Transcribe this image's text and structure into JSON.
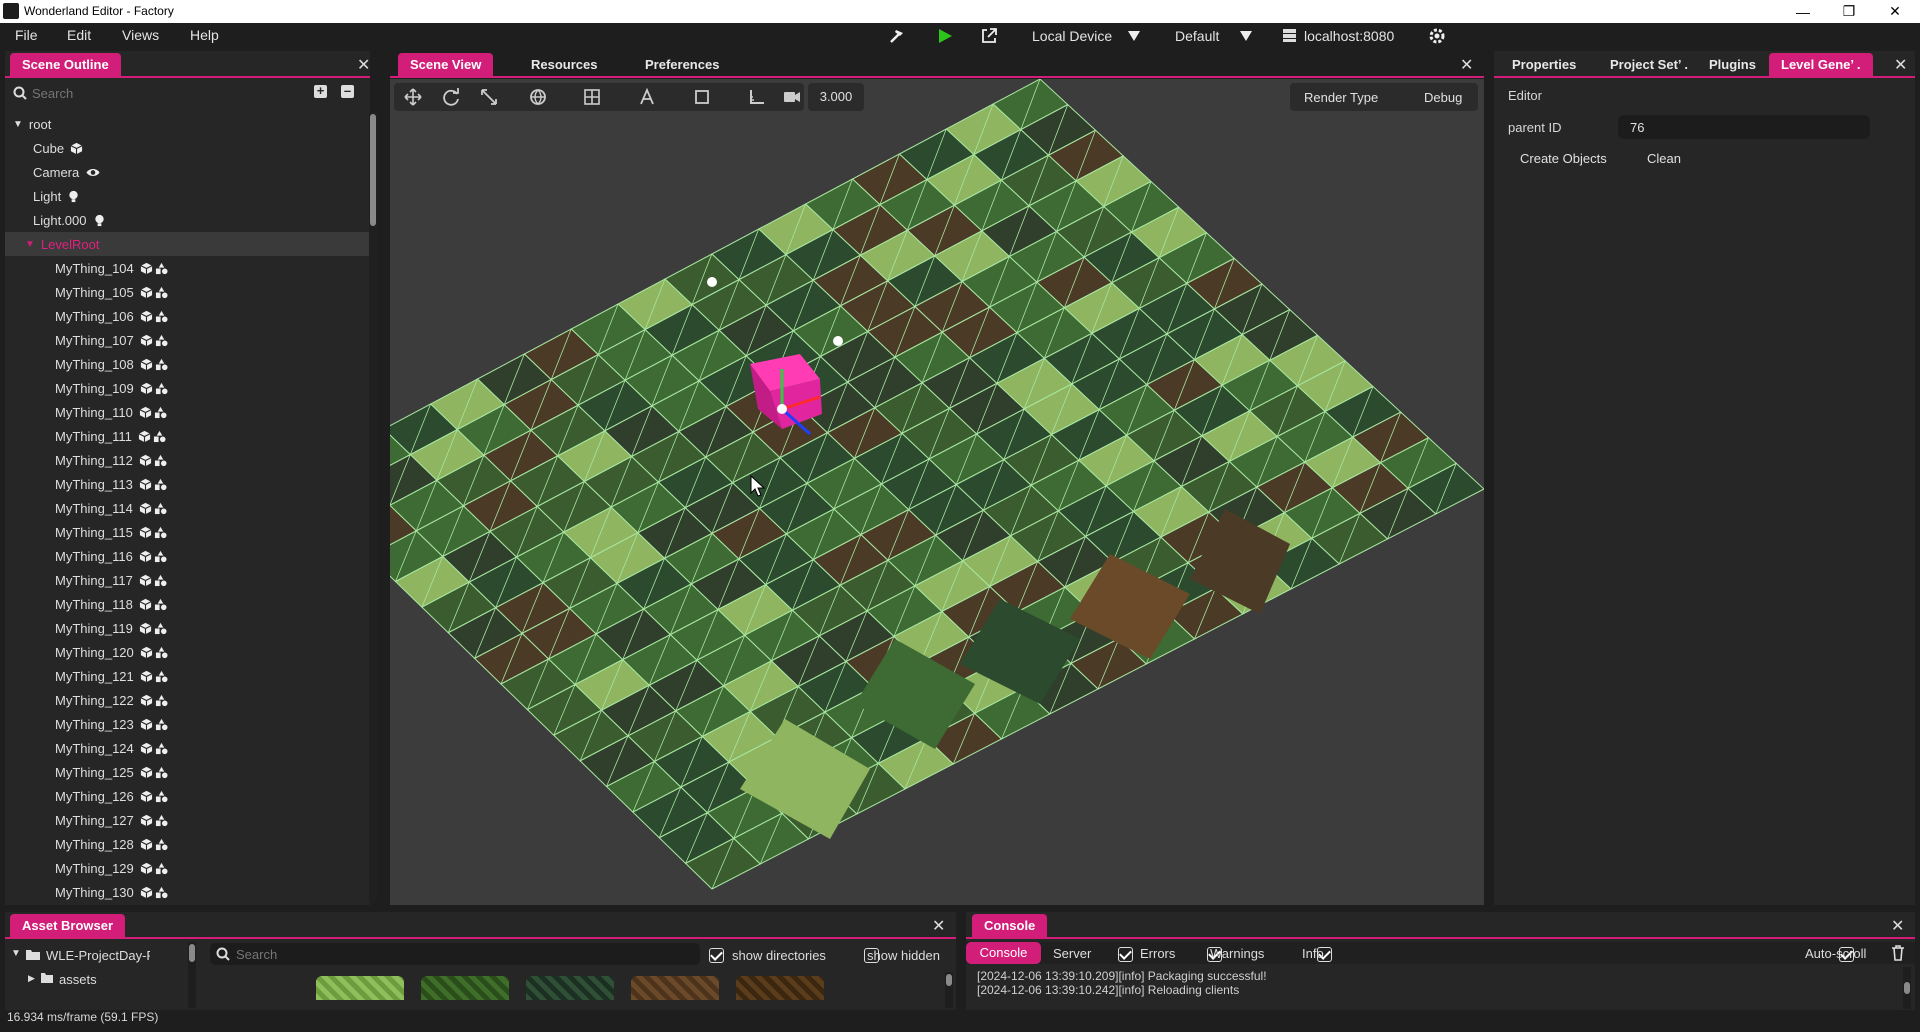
{
  "window": {
    "title": "Wonderland Editor - Factory"
  },
  "menu": [
    "File",
    "Edit",
    "Views",
    "Help"
  ],
  "toolbar": {
    "device": "Local Device",
    "profile": "Default",
    "server": "localhost:8080"
  },
  "scene_outline": {
    "tab": "Scene Outline",
    "search_placeholder": "Search",
    "items": [
      {
        "label": "root"
      },
      {
        "label": "Cube"
      },
      {
        "label": "Camera"
      },
      {
        "label": "Light"
      },
      {
        "label": "Light.000"
      },
      {
        "label": "LevelRoot"
      },
      {
        "label": "MyThing_104"
      },
      {
        "label": "MyThing_105"
      },
      {
        "label": "MyThing_106"
      },
      {
        "label": "MyThing_107"
      },
      {
        "label": "MyThing_108"
      },
      {
        "label": "MyThing_109"
      },
      {
        "label": "MyThing_110"
      },
      {
        "label": "MyThing_111"
      },
      {
        "label": "MyThing_112"
      },
      {
        "label": "MyThing_113"
      },
      {
        "label": "MyThing_114"
      },
      {
        "label": "MyThing_115"
      },
      {
        "label": "MyThing_116"
      },
      {
        "label": "MyThing_117"
      },
      {
        "label": "MyThing_118"
      },
      {
        "label": "MyThing_119"
      },
      {
        "label": "MyThing_120"
      },
      {
        "label": "MyThing_121"
      },
      {
        "label": "MyThing_122"
      },
      {
        "label": "MyThing_123"
      },
      {
        "label": "MyThing_124"
      },
      {
        "label": "MyThing_125"
      },
      {
        "label": "MyThing_126"
      },
      {
        "label": "MyThing_127"
      },
      {
        "label": "MyThing_128"
      },
      {
        "label": "MyThing_129"
      },
      {
        "label": "MyThing_130"
      }
    ]
  },
  "center_tabs": {
    "scene_view": "Scene View",
    "resources": "Resources",
    "preferences": "Preferences"
  },
  "scene_view": {
    "zoom": "3.000",
    "render_type": "Render Type",
    "debug": "Debug"
  },
  "right_tabs": {
    "properties": "Properties",
    "project_settings": "Project Set’ .",
    "plugins": "Plugins",
    "level_generator": "Level Gene’ ."
  },
  "level_gen": {
    "section": "Editor",
    "parent_id_label": "parent ID",
    "parent_id_value": "76",
    "create_objects": "Create Objects",
    "clean": "Clean"
  },
  "asset_browser": {
    "tab": "Asset Browser",
    "root_folder": "WLE-ProjectDay-Facto",
    "sub_folder": "assets",
    "search_placeholder": "Search",
    "show_directories": "show directories",
    "show_hidden": "show hidden"
  },
  "console": {
    "tab": "Console",
    "sub_tabs": {
      "console": "Console",
      "server": "Server"
    },
    "filters": {
      "errors": "Errors",
      "warnings": "Warnings",
      "info": "Info",
      "autoscroll": "Auto-scroll"
    },
    "lines": [
      "[2024-12-06 13:39:10.209][info] Packaging successful!",
      "[2024-12-06 13:39:10.242][info] Reloading clients"
    ]
  },
  "status": {
    "fps": "16.934 ms/frame (59.1 FPS)"
  },
  "colors": {
    "accent": "#d21e78",
    "panel": "#262626",
    "background": "#1e1e1e"
  }
}
